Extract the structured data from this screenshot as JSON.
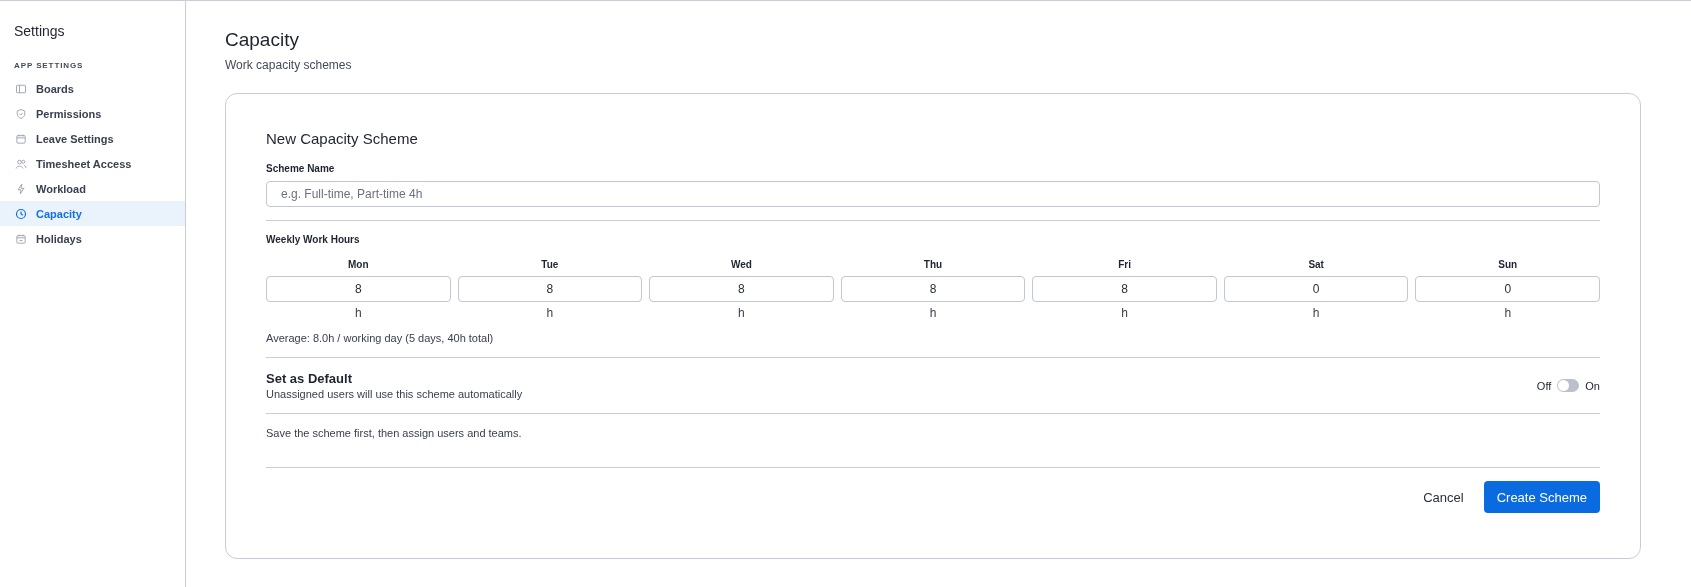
{
  "sidebar": {
    "title": "Settings",
    "section": "APP SETTINGS",
    "items": [
      {
        "label": "Boards",
        "selected": false
      },
      {
        "label": "Permissions",
        "selected": false
      },
      {
        "label": "Leave Settings",
        "selected": false
      },
      {
        "label": "Timesheet Access",
        "selected": false
      },
      {
        "label": "Workload",
        "selected": false
      },
      {
        "label": "Capacity",
        "selected": true
      },
      {
        "label": "Holidays",
        "selected": false
      }
    ]
  },
  "page": {
    "title": "Capacity",
    "subtitle": "Work capacity schemes"
  },
  "form": {
    "title": "New Capacity Scheme",
    "name_label": "Scheme Name",
    "name_placeholder": "e.g. Full-time, Part-time 4h",
    "hours_label": "Weekly Work Hours",
    "days": [
      {
        "day": "Mon",
        "value": "8",
        "unit": "h"
      },
      {
        "day": "Tue",
        "value": "8",
        "unit": "h"
      },
      {
        "day": "Wed",
        "value": "8",
        "unit": "h"
      },
      {
        "day": "Thu",
        "value": "8",
        "unit": "h"
      },
      {
        "day": "Fri",
        "value": "8",
        "unit": "h"
      },
      {
        "day": "Sat",
        "value": "0",
        "unit": "h"
      },
      {
        "day": "Sun",
        "value": "0",
        "unit": "h"
      }
    ],
    "average": "Average: 8.0h / working day (5 days, 40h total)",
    "default": {
      "title": "Set as Default",
      "description": "Unassigned users will use this scheme automatically",
      "off_label": "Off",
      "on_label": "On",
      "on": false
    },
    "note": "Save the scheme first, then assign users and teams.",
    "cancel": "Cancel",
    "submit": "Create Scheme"
  }
}
